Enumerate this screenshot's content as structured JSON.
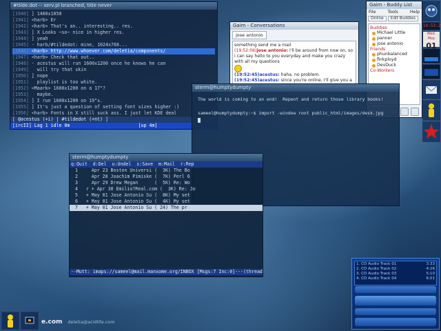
{
  "irc": {
    "title": "#tilde.dot -- serv.pl branched, title never",
    "lines": [
      {
        "n": "1940",
        "t": "] 1400x1050"
      },
      {
        "n": "1941",
        "t": "<harb> Er"
      },
      {
        "n": "1942",
        "t": "<harb> That's an.. interesting.. res."
      },
      {
        "n": "1943",
        "t": "] X Looks ~so~ nice in higher res."
      },
      {
        "n": "1944",
        "t": "] yeah"
      },
      {
        "n": "1945",
        "t": "- harb/#tildedot: mine, 1024x768..."
      },
      {
        "n": "1946",
        "t": "<harb> http://www.whoever.com/deletia/components/"
      },
      {
        "n": "1947",
        "t": "<harb> Check that out.."
      },
      {
        "n": "1948",
        "t": "- acestus will run 1600x1200 once he knows he can"
      },
      {
        "n": "1949",
        "t": "  will try that skin"
      },
      {
        "n": "1950",
        "t": "] nope"
      },
      {
        "n": "1951",
        "t": "  playlist is too white."
      },
      {
        "n": "1952",
        "t": "<Maark> 1600x1200 on a 17\"?"
      },
      {
        "n": "1953",
        "t": "  maybe."
      },
      {
        "n": "1954",
        "t": "] I run 1600x1200 on 19\"s."
      },
      {
        "n": "1955",
        "t": "] It's just a question of setting font sizes higher :)"
      },
      {
        "n": "1956",
        "t": "<harb> Fonts in X still suck ass. I just let KDE deal"
      },
      {
        "n": "1957",
        "t": "<harb> AH goodness."
      },
      {
        "n": "1958",
        "t": "] WM"
      },
      {
        "n": "1959",
        "t": "<Maark> http://www.winamp.com/skins/detail.jhtml;"
      },
      {
        "n": "",
        "t": "jsessionid=XMLHXCLRNFHTN2ZIHPCZ?componentId=45808 :--good s"
      }
    ],
    "status": "[ @acestus (+i) | #tildedot (+nt) ]",
    "status2": "[ircII] Lag 1 idle 0m                         [up 4m]"
  },
  "gaim_conv": {
    "title": "Gaim - Conversations",
    "tab": "jose antonio",
    "messages": [
      {
        "ts": "",
        "nick": "",
        "text": "something send me a mail",
        "color": "r"
      },
      {
        "ts": "(19:52:06)",
        "nick": "jose antonio:",
        "text": " i'll be around from now on, so i can say hello to you everyday and make you crazy with all my questions",
        "color": "r"
      },
      {
        "ts": "(19:52:45)",
        "nick": "acestus:",
        "text": " haha. no problem.",
        "color": "b"
      },
      {
        "ts": "(19:52:45)",
        "nick": "acestus:",
        "text": " since you're online, I'll give you a link to",
        "color": "b"
      }
    ]
  },
  "buddy": {
    "title": "Gaim - Buddy List",
    "menu": [
      "File",
      "Tools",
      "Help"
    ],
    "tabs": [
      "Online",
      "Edit Buddies"
    ],
    "groups": [
      {
        "name": "Buddies",
        "members": [
          "Michael Little",
          "panner",
          "jose antonio"
        ]
      },
      {
        "name": "Friends",
        "members": [
          "phunbalanced",
          "finkployd",
          "DevDuck"
        ]
      },
      {
        "name": "Co-Workers",
        "members": []
      }
    ]
  },
  "dock": {
    "time": "19:53:29",
    "date_dow": "Wed. May",
    "date_day": "01"
  },
  "xterm": {
    "title": "sterm@humptydumpty",
    "line1": "The world is coming to an end!  Repent and return those library books!",
    "prompt": "sameel@humptydumpty:~$ import -window root public_html/images/desk.jpg"
  },
  "mutt": {
    "title": "sterm@humptydumpty",
    "header": "q:Quit  d:Del  u:Undel  s:Save  m:Mail  r:Rep",
    "rows": [
      {
        "t": "  1     Apr 23 Boston Universi (  3K) The Bo"
      },
      {
        "t": "  2     Apr 28 Joachim Pimiske (  7K) Perl 6"
      },
      {
        "t": "  3     Apr 29 Drew Megan      (  5K) Re: Wo"
      },
      {
        "t": "  4   r + Apr 30 Emilio?Real.com (  3K) Re: Jo"
      },
      {
        "t": "  5   + May 01 Jose Antonio Su (  8K) My set"
      },
      {
        "t": "  6   + May 01 Jose Antonio Su (  4K) My set"
      },
      {
        "t": "  7   + May 01 Jose Antonio Su ( 24) The pr"
      }
    ],
    "selected_index": 6,
    "footer": "--Mutt: imaps://sameel@mail.manxome.org/INBOX [Msgs:7 Inc:0]---(threads/last-da"
  },
  "player": {
    "tracks": [
      {
        "name": "1. CD Audio Track 01",
        "dur": "3:33"
      },
      {
        "name": "2. CD Audio Track 02",
        "dur": "4:26"
      },
      {
        "name": "3. CD Audio Track 03",
        "dur": "5:10"
      },
      {
        "name": "4. CD Audio Track 04",
        "dur": "6:01"
      }
    ]
  },
  "brand": {
    "logo_text": "e.com",
    "credit": "deletia@acidlife.com"
  },
  "colors": {
    "accent": "#2d6cd6",
    "nick_red": "#c02020",
    "nick_blue": "#2040c0",
    "status_blue": "#1848c8"
  }
}
